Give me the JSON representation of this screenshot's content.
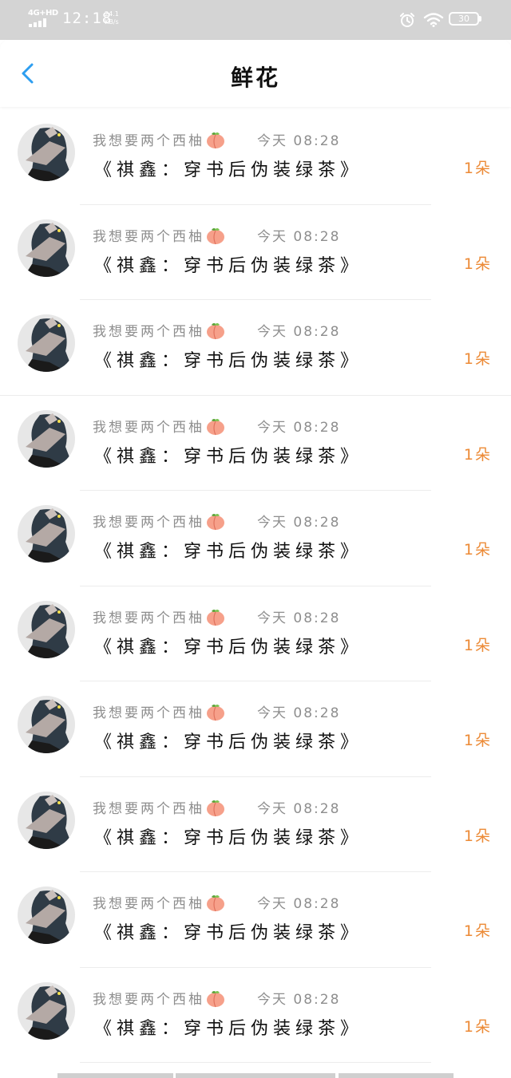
{
  "status_bar": {
    "signal_type": "4G+HD",
    "time": "12:18",
    "net_speed_value": "24.1",
    "net_speed_unit": "KB/s",
    "battery_level": "30"
  },
  "header": {
    "title": "鲜花",
    "back_icon": "chevron-left-icon",
    "accent_color": "#2d9ef0"
  },
  "list": {
    "items": [
      {
        "sender": "我想要两个西柚",
        "emoji": "peach-emoji",
        "time": "今天 08:28",
        "book": "《祺鑫：穿书后伪装绿茶》",
        "count": "1朵"
      },
      {
        "sender": "我想要两个西柚",
        "emoji": "peach-emoji",
        "time": "今天 08:28",
        "book": "《祺鑫：穿书后伪装绿茶》",
        "count": "1朵"
      },
      {
        "sender": "我想要两个西柚",
        "emoji": "peach-emoji",
        "time": "今天 08:28",
        "book": "《祺鑫：穿书后伪装绿茶》",
        "count": "1朵"
      },
      {
        "sender": "我想要两个西柚",
        "emoji": "peach-emoji",
        "time": "今天 08:28",
        "book": "《祺鑫：穿书后伪装绿茶》",
        "count": "1朵"
      },
      {
        "sender": "我想要两个西柚",
        "emoji": "peach-emoji",
        "time": "今天 08:28",
        "book": "《祺鑫：穿书后伪装绿茶》",
        "count": "1朵"
      },
      {
        "sender": "我想要两个西柚",
        "emoji": "peach-emoji",
        "time": "今天 08:28",
        "book": "《祺鑫：穿书后伪装绿茶》",
        "count": "1朵"
      },
      {
        "sender": "我想要两个西柚",
        "emoji": "peach-emoji",
        "time": "今天 08:28",
        "book": "《祺鑫：穿书后伪装绿茶》",
        "count": "1朵"
      },
      {
        "sender": "我想要两个西柚",
        "emoji": "peach-emoji",
        "time": "今天 08:28",
        "book": "《祺鑫：穿书后伪装绿茶》",
        "count": "1朵"
      },
      {
        "sender": "我想要两个西柚",
        "emoji": "peach-emoji",
        "time": "今天 08:28",
        "book": "《祺鑫：穿书后伪装绿茶》",
        "count": "1朵"
      },
      {
        "sender": "我想要两个西柚",
        "emoji": "peach-emoji",
        "time": "今天 08:28",
        "book": "《祺鑫：穿书后伪装绿茶》",
        "count": "1朵"
      }
    ]
  },
  "colors": {
    "count_color": "#ec8a36",
    "meta_text": "#8e8e8e",
    "status_bar_bg": "#d4d4d4"
  }
}
